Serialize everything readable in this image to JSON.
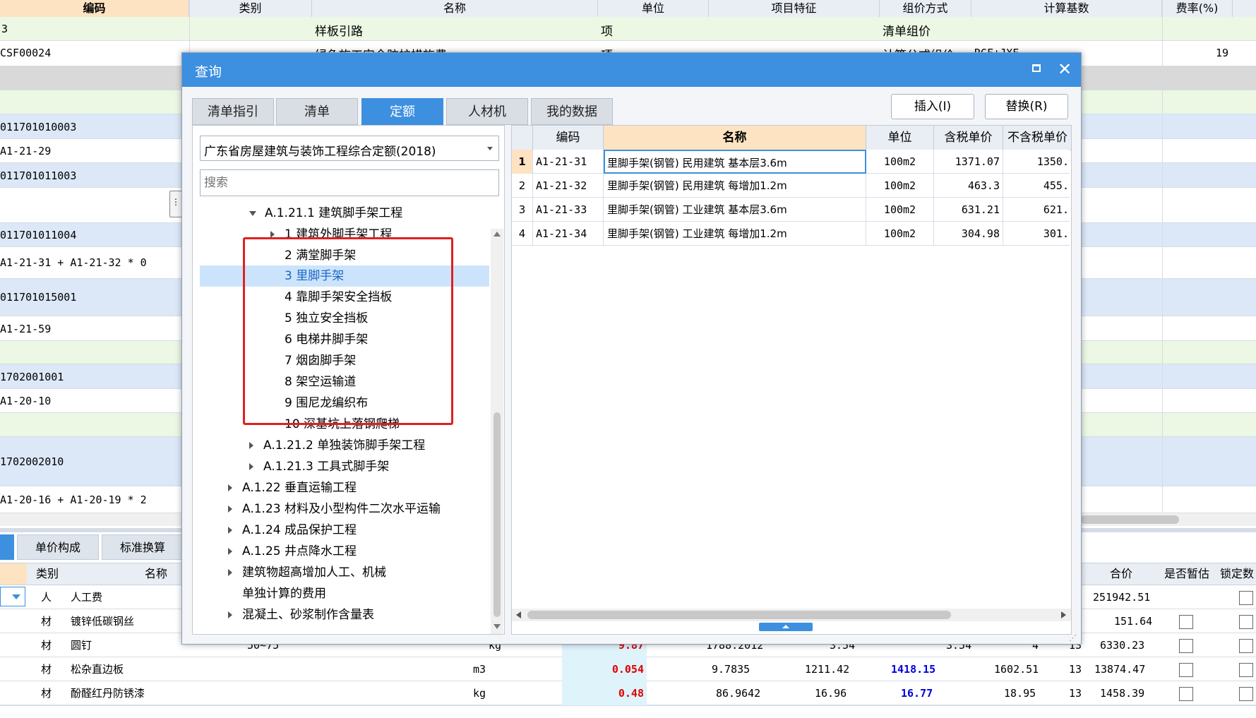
{
  "main_grid": {
    "headers": [
      "编码",
      "类别",
      "名称",
      "单位",
      "项目特征",
      "组价方式",
      "计算基数",
      "费率(%)"
    ],
    "rows": [
      {
        "code": "3",
        "name": "样板引路",
        "unit": "项",
        "method": "清单组价"
      },
      {
        "code": "CSF00024",
        "name": "绿色施工安全防护措施费",
        "unit": "项",
        "method": "计算公式组价",
        "base": "RGF+JXF",
        "rate": "19"
      },
      {
        "code": ""
      },
      {
        "code": ""
      },
      {
        "code": "011701010003"
      },
      {
        "code": "A1-21-29"
      },
      {
        "code": "011701011003"
      },
      {
        "code": ""
      },
      {
        "code": "011701011004"
      },
      {
        "code": "A1-21-31 + A1-21-32 * 0"
      },
      {
        "code": "011701015001"
      },
      {
        "code": "A1-21-59"
      },
      {
        "code": ""
      },
      {
        "code": "1702001001"
      },
      {
        "code": "A1-20-10"
      },
      {
        "code": ""
      },
      {
        "code": "1702002010"
      },
      {
        "code": "A1-20-16 + A1-20-19 * 2"
      }
    ]
  },
  "bottom_panel": {
    "tabs": [
      "单价构成",
      "标准换算"
    ],
    "headers": {
      "type": "类别",
      "name": "名称",
      "total": "合价",
      "provisional": "是否暂估",
      "locked": "锁定数"
    },
    "rows": [
      {
        "type": "人",
        "name": "人工费",
        "total": "251942.51"
      },
      {
        "type": "材",
        "name": "镀锌低碳钢丝",
        "total": "151.64"
      },
      {
        "type": "材",
        "name": "圆钉",
        "spec": "50~75",
        "unit": "kg",
        "qty": "9.87",
        "v1": "1788.2012",
        "v2": "3.54",
        "v3": "3.54",
        "v4": "4",
        "rate": "13",
        "total": "6330.23"
      },
      {
        "type": "材",
        "name": "松杂直边板",
        "spec": "",
        "unit": "m3",
        "qty": "0.054",
        "v1": "9.7835",
        "v2": "1211.42",
        "v3": "1418.15",
        "v4": "1602.51",
        "rate": "13",
        "total": "13874.47"
      },
      {
        "type": "材",
        "name": "酚醛红丹防锈漆",
        "spec": "",
        "unit": "kg",
        "qty": "0.48",
        "v1": "86.9642",
        "v2": "16.96",
        "v3": "16.77",
        "v4": "18.95",
        "rate": "13",
        "total": "1458.39"
      }
    ]
  },
  "dialog": {
    "title": "查询",
    "tabs": [
      "清单指引",
      "清单",
      "定额",
      "人材机",
      "我的数据"
    ],
    "active_tab": "定额",
    "insert_label": "插入(I)",
    "replace_label": "替换(R)",
    "quota_select": "广东省房屋建筑与装饰工程综合定额(2018)",
    "search_placeholder": "搜索",
    "tree": [
      {
        "label": "A.1.21.1 建筑脚手架工程",
        "level": 2,
        "arrow": "down"
      },
      {
        "label": "1 建筑外脚手架工程",
        "level": 3,
        "arrow": "right"
      },
      {
        "label": "2 满堂脚手架",
        "level": 3
      },
      {
        "label": "3 里脚手架",
        "level": 3,
        "selected": true
      },
      {
        "label": "4 靠脚手架安全挡板",
        "level": 3
      },
      {
        "label": "5 独立安全挡板",
        "level": 3
      },
      {
        "label": "6 电梯井脚手架",
        "level": 3
      },
      {
        "label": "7 烟囱脚手架",
        "level": 3
      },
      {
        "label": "8 架空运输道",
        "level": 3
      },
      {
        "label": "9 围尼龙编织布",
        "level": 3
      },
      {
        "label": "10 深基坑上落钢爬梯",
        "level": 3
      },
      {
        "label": "A.1.21.2 单独装饰脚手架工程",
        "level": 2,
        "arrow": "right"
      },
      {
        "label": "A.1.21.3 工具式脚手架",
        "level": 2,
        "arrow": "right"
      },
      {
        "label": "A.1.22 垂直运输工程",
        "level": 1,
        "arrow": "right"
      },
      {
        "label": "A.1.23 材料及小型构件二次水平运输",
        "level": 1,
        "arrow": "right"
      },
      {
        "label": "A.1.24 成品保护工程",
        "level": 1,
        "arrow": "right"
      },
      {
        "label": "A.1.25 井点降水工程",
        "level": 1,
        "arrow": "right"
      },
      {
        "label": "建筑物超高增加人工、机械",
        "level": 1,
        "arrow": "right"
      },
      {
        "label": "单独计算的费用",
        "level": 1
      },
      {
        "label": "混凝土、砂浆制作含量表",
        "level": 1,
        "arrow": "right"
      }
    ],
    "table_headers": [
      "编码",
      "名称",
      "单位",
      "含税单价",
      "不含税单价"
    ],
    "table_rows": [
      {
        "no": "1",
        "code": "A1-21-31",
        "name": "里脚手架(钢管) 民用建筑 基本层3.6m",
        "unit": "100m2",
        "price_tax": "1371.07",
        "price_notax": "1350."
      },
      {
        "no": "2",
        "code": "A1-21-32",
        "name": "里脚手架(钢管) 民用建筑 每增加1.2m",
        "unit": "100m2",
        "price_tax": "463.3",
        "price_notax": "455."
      },
      {
        "no": "3",
        "code": "A1-21-33",
        "name": "里脚手架(钢管) 工业建筑 基本层3.6m",
        "unit": "100m2",
        "price_tax": "631.21",
        "price_notax": "621."
      },
      {
        "no": "4",
        "code": "A1-21-34",
        "name": "里脚手架(钢管) 工业建筑 每增加1.2m",
        "unit": "100m2",
        "price_tax": "304.98",
        "price_notax": "301."
      }
    ]
  },
  "colors": {
    "accent": "#3d8fe0",
    "highlight_box": "#e02020",
    "selected_row": "#cce4fb",
    "red_value": "#e00000",
    "blue_value": "#0000e0"
  }
}
